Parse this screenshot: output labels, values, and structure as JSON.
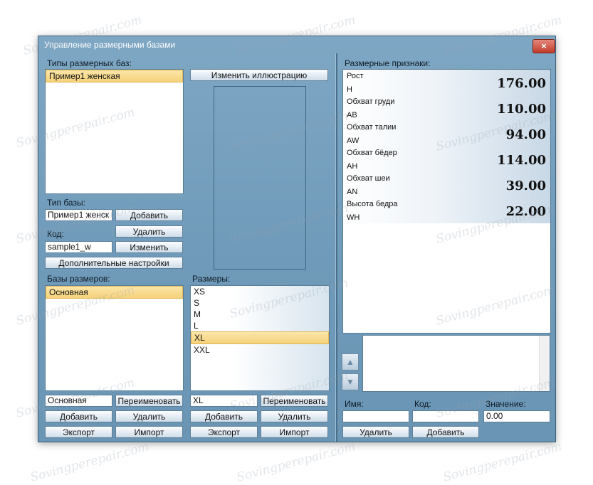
{
  "window": {
    "title": "Управление размерными базами",
    "close": "×"
  },
  "left": {
    "types_label": "Типы размерных баз:",
    "types": [
      "Пример1 женская"
    ],
    "change_illustration": "Изменить иллюстрацию",
    "base_type_label": "Тип базы:",
    "base_type_value": "Пример1 женск",
    "add": "Добавить",
    "delete": "Удалить",
    "code_label": "Код:",
    "code_value": "sample1_w",
    "change": "Изменить",
    "advanced": "Дополнительные настройки",
    "bases_label": "Базы размеров:",
    "bases": [
      "Основная"
    ],
    "base_name_value": "Основная",
    "rename": "Переименовать",
    "export": "Экспорт",
    "import": "Импорт"
  },
  "sizes": {
    "label": "Размеры:",
    "items": [
      "XS",
      "S",
      "M",
      "L",
      "XL",
      "XXL"
    ],
    "selected": "XL",
    "value": "XL",
    "rename": "Переименовать",
    "add": "Добавить",
    "delete": "Удалить",
    "export": "Экспорт",
    "import": "Импорт"
  },
  "right": {
    "props_label": "Размерные признаки:",
    "props": [
      {
        "name": "Рост",
        "code": "H",
        "value": "176.00"
      },
      {
        "name": "Обхват груди",
        "code": "AB",
        "value": "110.00"
      },
      {
        "name": "Обхват талии",
        "code": "AW",
        "value": "94.00"
      },
      {
        "name": "Обхват бёдер",
        "code": "AH",
        "value": "114.00"
      },
      {
        "name": "Обхват шеи",
        "code": "AN",
        "value": "39.00"
      },
      {
        "name": "Высота бедра",
        "code": "WH",
        "value": "22.00"
      }
    ],
    "name_label": "Имя:",
    "code_label": "Код:",
    "value_label": "Значение:",
    "value_field": "0.00",
    "delete": "Удалить",
    "add": "Добавить"
  },
  "watermark": "Sovingperepair.com",
  "colors": {
    "selection": "#f5d27a",
    "window": "#7ea7c4",
    "close": "#c13b2b"
  }
}
